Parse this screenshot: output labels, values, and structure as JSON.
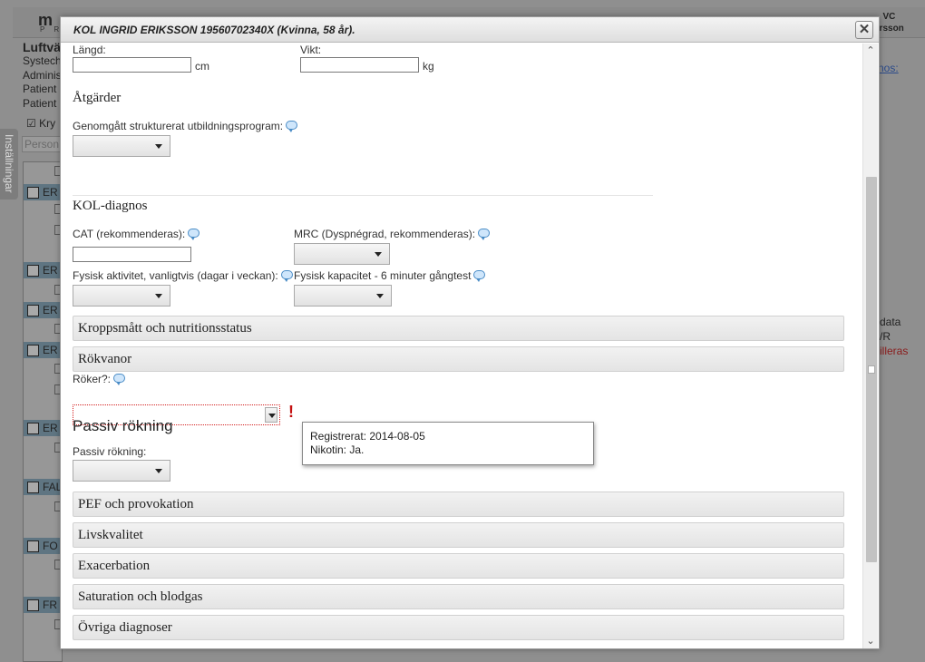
{
  "background": {
    "logo": "m",
    "logo_sub": "P R",
    "user_line1": "VC",
    "user_line2": "arsson",
    "page_title": "Luftvä",
    "info_lines": [
      "Systech",
      "Adminis",
      "Patient",
      "Patient"
    ],
    "checkbox_label": "Kry",
    "search_placeholder": "Person",
    "side_tab": "Inställningar",
    "rows": [
      "ER",
      "ER",
      "ER",
      "ER",
      "ER",
      "FAL",
      "FO",
      "FR"
    ],
    "right_link": "nos:",
    "right_texts": [
      "data",
      "/R"
    ],
    "right_red": "illeras"
  },
  "modal": {
    "title": "KOL INGRID ERIKSSON 19560702340X (Kvinna, 58 år).",
    "close_symbol": "✕",
    "fields": {
      "length_label": "Längd:",
      "length_unit": "cm",
      "weight_label": "Vikt:",
      "weight_unit": "kg"
    },
    "atgarder": {
      "heading": "Åtgärder",
      "program_label": "Genomgått strukturerat utbildningsprogram:"
    },
    "kol_diagnos": {
      "heading": "KOL-diagnos",
      "cat_label": "CAT (rekommenderas):",
      "mrc_label": "MRC (Dyspnégrad, rekommenderas):",
      "fys_akt_label": "Fysisk aktivitet, vanligtvis (dagar i veckan):",
      "fys_kap_label": "Fysisk kapacitet - 6 minuter gångtest"
    },
    "sections_top": [
      "Kroppsmått och nutritionsstatus",
      "Rökvanor"
    ],
    "rokvanor": {
      "roker_label": "Röker?:",
      "error_mark": "!"
    },
    "tooltip": {
      "line1": "Registrerat: 2014-08-05",
      "line2": "Nikotin: Ja."
    },
    "passiv": {
      "heading": "Passiv rökning",
      "label": "Passiv rökning:"
    },
    "sections_bottom": [
      "PEF och provokation",
      "Livskvalitet",
      "Exacerbation",
      "Saturation och blodgas",
      "Övriga diagnoser"
    ]
  }
}
